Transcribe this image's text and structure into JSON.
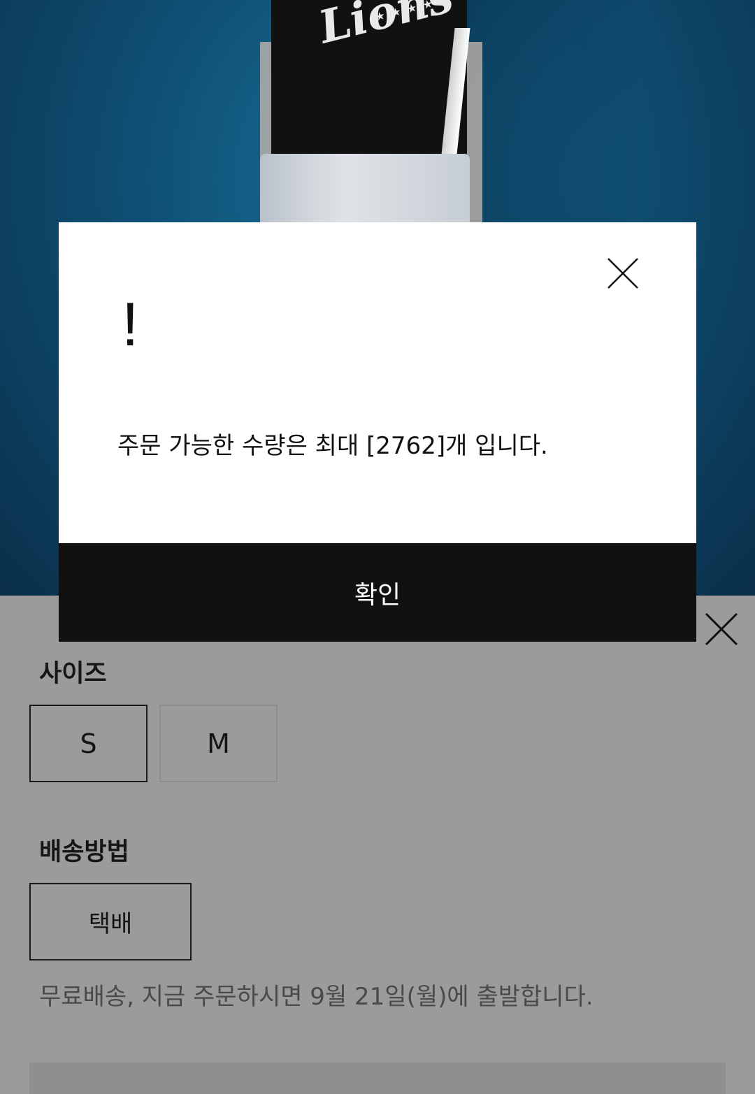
{
  "modal": {
    "alert_symbol": "!",
    "message": "주문 가능한 수량은 최대 [2762]개 입니다.",
    "confirm_label": "확인",
    "close_icon": "close-icon"
  },
  "hero": {
    "shirt_print": "Lions",
    "stars": "★ ★ ★ ★ ★"
  },
  "sheet": {
    "close_icon": "close-icon",
    "size_title": "사이즈",
    "sizes": [
      {
        "label": "S",
        "state": "selected"
      },
      {
        "label": "M",
        "state": "available"
      }
    ],
    "shipping_title": "배송방법",
    "shipping_options": [
      {
        "label": "택배",
        "state": "selected"
      }
    ],
    "shipping_note": "무료배송, 지금 주문하시면 9월 21일(월)에 출발합니다."
  },
  "colors": {
    "modal_button_bg": "#111111",
    "overlay_sheet": "#9b9b9b"
  }
}
